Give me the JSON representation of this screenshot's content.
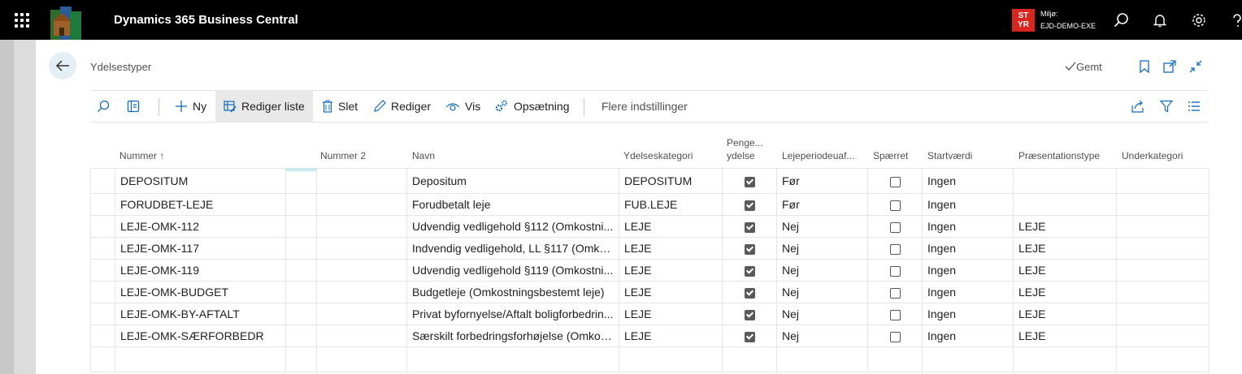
{
  "app": {
    "title": "Dynamics 365 Business Central"
  },
  "environment": {
    "badge_line1": "ST",
    "badge_line2": "YR",
    "label": "Miljø:",
    "name": "EJD-DEMO-EXE"
  },
  "page": {
    "title": "Ydelsestyper",
    "status": "Gemt"
  },
  "toolbar": {
    "new_label": "Ny",
    "edit_list_label": "Rediger liste",
    "delete_label": "Slet",
    "edit_label": "Rediger",
    "view_label": "Vis",
    "setup_label": "Opsætning",
    "more_label": "Flere indstillinger"
  },
  "columns": {
    "nummer": "Nummer ↑",
    "nummer2": "Nummer 2",
    "navn": "Navn",
    "ydelseskategori": "Ydelseskategori",
    "penge_line1": "Penge...",
    "penge_line2": "ydelse",
    "lejeperiode": "Lejeperiodeuaf...",
    "spaerret": "Spærret",
    "startvaerdi": "Startværdi",
    "praesentationstype": "Præsentationstype",
    "underkategori": "Underkategori"
  },
  "rows": [
    {
      "nummer": "DEPOSITUM",
      "nummer2": "",
      "navn": "Depositum",
      "kategori": "DEPOSITUM",
      "penge": true,
      "leje": "Før",
      "spaerret": false,
      "start": "Ingen",
      "praes": "",
      "under": ""
    },
    {
      "nummer": "FORUDBET-LEJE",
      "nummer2": "",
      "navn": "Forudbetalt leje",
      "kategori": "FUB.LEJE",
      "penge": true,
      "leje": "Før",
      "spaerret": false,
      "start": "Ingen",
      "praes": "",
      "under": ""
    },
    {
      "nummer": "LEJE-OMK-112",
      "nummer2": "",
      "navn": "Udvendig vedligehold §112 (Omkostni...",
      "kategori": "LEJE",
      "penge": true,
      "leje": "Nej",
      "spaerret": false,
      "start": "Ingen",
      "praes": "LEJE",
      "under": ""
    },
    {
      "nummer": "LEJE-OMK-117",
      "nummer2": "",
      "navn": "Indvendig vedligehold, LL §117 (Omk. l...",
      "kategori": "LEJE",
      "penge": true,
      "leje": "Nej",
      "spaerret": false,
      "start": "Ingen",
      "praes": "LEJE",
      "under": ""
    },
    {
      "nummer": "LEJE-OMK-119",
      "nummer2": "",
      "navn": "Udvendig vedligehold §119 (Omkostni...",
      "kategori": "LEJE",
      "penge": true,
      "leje": "Nej",
      "spaerret": false,
      "start": "Ingen",
      "praes": "LEJE",
      "under": ""
    },
    {
      "nummer": "LEJE-OMK-BUDGET",
      "nummer2": "",
      "navn": "Budgetleje (Omkostningsbestemt leje)",
      "kategori": "LEJE",
      "penge": true,
      "leje": "Nej",
      "spaerret": false,
      "start": "Ingen",
      "praes": "LEJE",
      "under": ""
    },
    {
      "nummer": "LEJE-OMK-BY-AFTALT",
      "nummer2": "",
      "navn": "Privat byfornyelse/Aftalt boligforbedrin...",
      "kategori": "LEJE",
      "penge": true,
      "leje": "Nej",
      "spaerret": false,
      "start": "Ingen",
      "praes": "LEJE",
      "under": ""
    },
    {
      "nummer": "LEJE-OMK-SÆRFORBEDR",
      "nummer2": "",
      "navn": "Særskilt forbedringsforhøjelse (Omkost...",
      "kategori": "LEJE",
      "penge": true,
      "leje": "Nej",
      "spaerret": false,
      "start": "Ingen",
      "praes": "LEJE",
      "under": ""
    }
  ],
  "colors": {
    "topbar": "#000000",
    "badge": "#d9251c",
    "accent": "#0f6cbd"
  }
}
